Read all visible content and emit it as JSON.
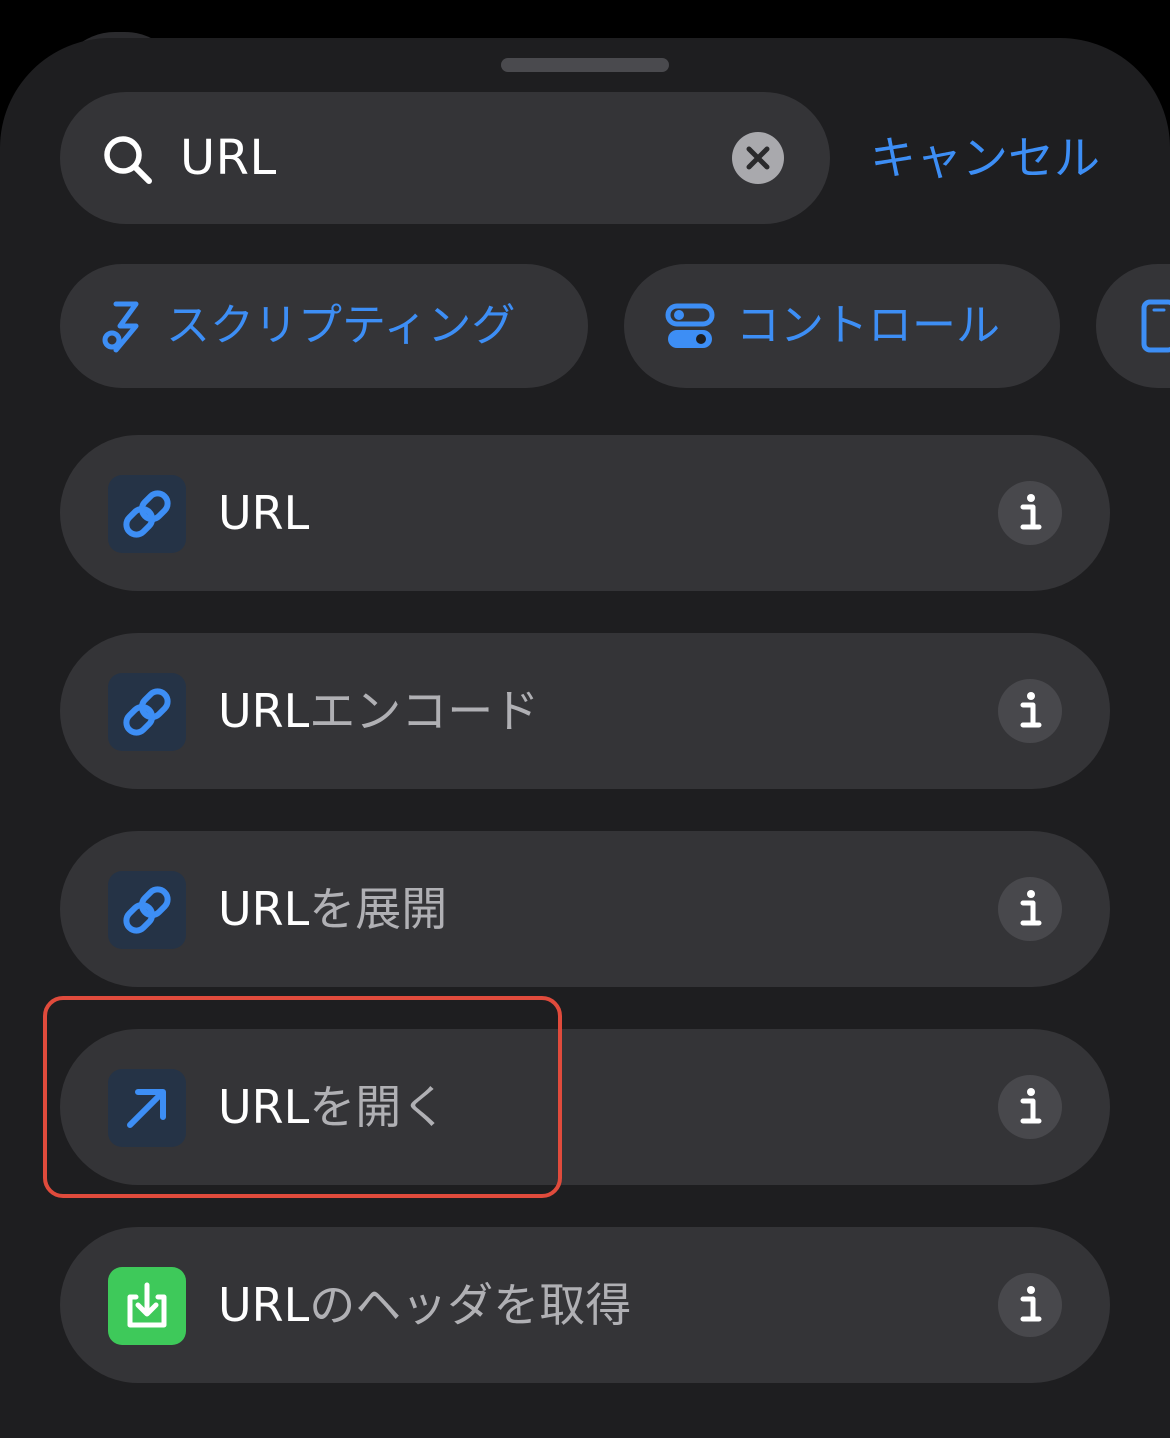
{
  "colors": {
    "accent": "#3d8ef5",
    "sheet_background": "#1e1e20",
    "control_background": "#343437",
    "highlight_box": "#e04b3c",
    "green_icon": "#3ec95a"
  },
  "search": {
    "icon": "search-icon",
    "query": "URL",
    "clear_icon": "clear-icon",
    "cancel_label": "キャンセル"
  },
  "categories": [
    {
      "label": "スクリプティング",
      "icon": "scripting-icon"
    },
    {
      "label": "コントロール",
      "icon": "controls-toggle-icon"
    },
    {
      "label": "",
      "icon": "device-icon"
    }
  ],
  "results": [
    {
      "match": "URL",
      "rest": "",
      "icon": "link-icon"
    },
    {
      "match": "URL",
      "rest": "エンコード",
      "icon": "link-icon"
    },
    {
      "match": "URL",
      "rest": "を展開",
      "icon": "link-icon"
    },
    {
      "match": "URL",
      "rest": "を開く",
      "icon": "open-arrow-icon",
      "highlighted": true
    },
    {
      "match": "URL",
      "rest": "のヘッダを取得",
      "icon": "download-icon"
    }
  ],
  "info_button_icon": "info-icon"
}
